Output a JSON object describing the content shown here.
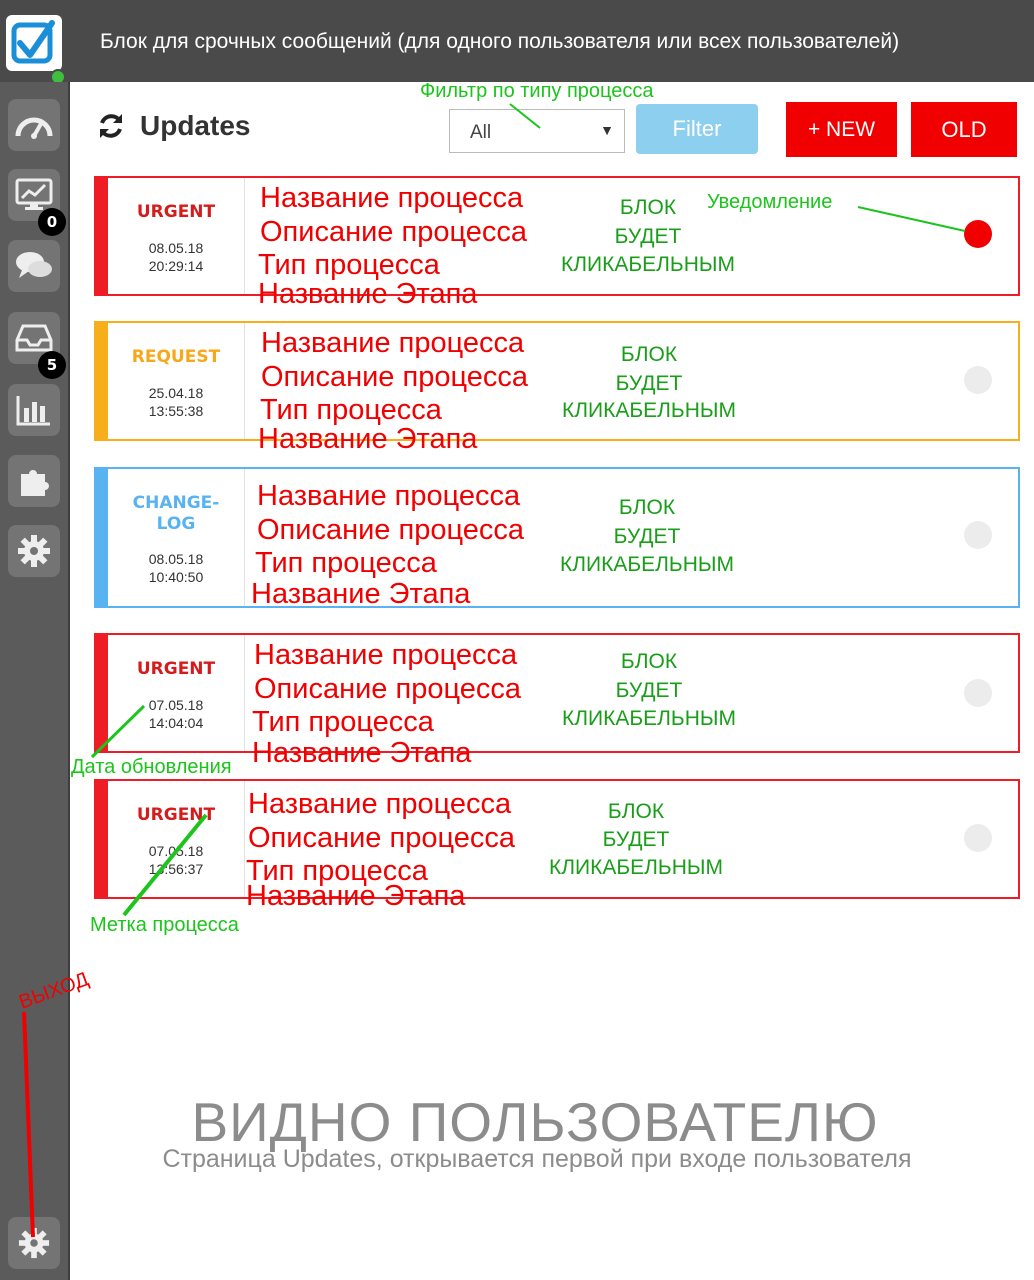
{
  "banner": "Блок для срочных сообщений (для одного пользователя или всех пользователей)",
  "sidebar": {
    "badges": [
      "0",
      "5"
    ]
  },
  "header": {
    "title": "Updates",
    "filter_select_value": "All",
    "filter_button": "Filter",
    "new_button": "+ NEW",
    "old_button": "OLD"
  },
  "cards": [
    {
      "tag": "URGENT",
      "date": "08.05.18",
      "time": "20:29:14",
      "color": "#ee1c24",
      "name": "Название процесса",
      "description": "Описание процесса",
      "type": "Тип процесса",
      "stage": "Название Этапа",
      "clickable": [
        "БЛОК",
        "БУДЕТ",
        "КЛИКАБЕЛЬНЫМ"
      ],
      "notification_active": true
    },
    {
      "tag": "REQUEST",
      "date": "25.04.18",
      "time": "13:55:38",
      "color": "#f6ae1a",
      "name": "Название процесса",
      "description": "Описание процесса",
      "type": "Тип процесса",
      "stage": "Название Этапа",
      "clickable": [
        "БЛОК",
        "БУДЕТ",
        "КЛИКАБЕЛЬНЫМ"
      ],
      "notification_active": false
    },
    {
      "tag_line1": "CHANGE-",
      "tag_line2": "LOG",
      "date": "08.05.18",
      "time": "10:40:50",
      "color": "#58b3f0",
      "name": "Название процесса",
      "description": "Описание процесса",
      "type": "Тип процесса",
      "stage": "Название Этапа",
      "clickable": [
        "БЛОК",
        "БУДЕТ",
        "КЛИКАБЕЛЬНЫМ"
      ],
      "notification_active": false
    },
    {
      "tag": "URGENT",
      "date": "07.05.18",
      "time": "14:04:04",
      "color": "#ee1c24",
      "name": "Название процесса",
      "description": "Описание процесса",
      "type": "Тип процесса",
      "stage": "Название Этапа",
      "clickable": [
        "БЛОК",
        "БУДЕТ",
        "КЛИКАБЕЛЬНЫМ"
      ],
      "notification_active": false
    },
    {
      "tag": "URGENT",
      "date": "07.05.18",
      "time": "13:56:37",
      "color": "#ee1c24",
      "name": "Название процесса",
      "description": "Описание процесса",
      "type": "Тип процесса",
      "stage": "Название Этапа",
      "clickable": [
        "БЛОК",
        "БУДЕТ",
        "КЛИКАБЕЛЬНЫМ"
      ],
      "notification_active": false
    }
  ],
  "annotations": {
    "filter_by_type": "Фильтр по типу процесса",
    "notification": "Уведомление",
    "update_date": "Дата обновления",
    "process_label": "Метка процесса",
    "logout": "ВЫХОД"
  },
  "footer": {
    "title": "ВИДНО ПОЛЬЗОВАТЕЛЮ",
    "subtitle": "Страница Updates, открывается первой при входе пользователя"
  },
  "icons": [
    "logo-check-icon",
    "dashboard-gauge-icon",
    "monitor-chart-icon",
    "chat-bubbles-icon",
    "inbox-tray-icon",
    "bar-chart-icon",
    "puzzle-icon",
    "gear-icon",
    "refresh-icon",
    "dropdown-arrow-icon",
    "logout-gear-icon"
  ]
}
